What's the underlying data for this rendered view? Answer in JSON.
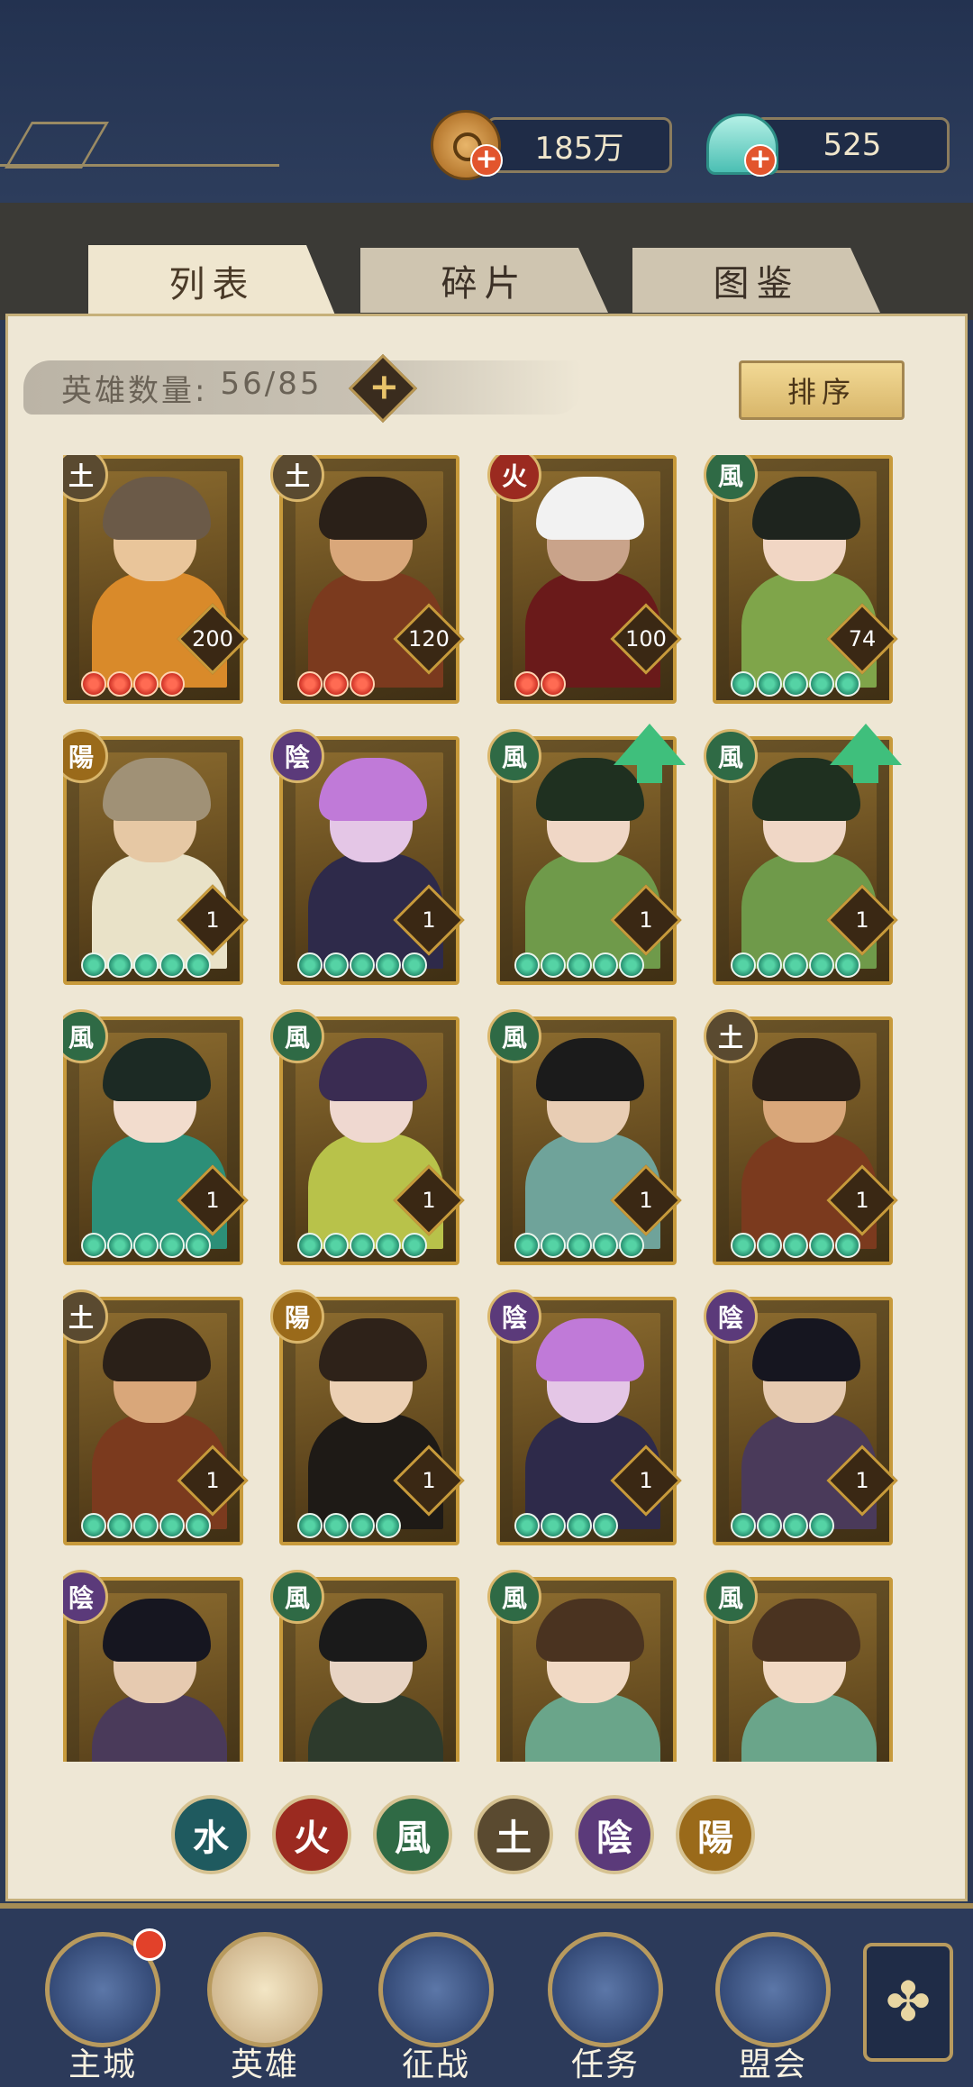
{
  "currency": {
    "coins": "185万",
    "shells": "525"
  },
  "tabs": [
    {
      "label": "列表",
      "active": true
    },
    {
      "label": "碎片",
      "active": false
    },
    {
      "label": "图鉴",
      "active": false
    }
  ],
  "hero_count": {
    "label": "英雄数量:",
    "value": "56/85"
  },
  "sort_button": "排序",
  "element_colors": {
    "土": "#5a4a30",
    "火": "#9b2a20",
    "風": "#2f6a45",
    "陽": "#9a6a1a",
    "陰": "#5b3a7a",
    "水": "#1f5a5f"
  },
  "heroes": [
    {
      "element": "土",
      "level": "200",
      "stars": 4,
      "star_color": "red",
      "upgrade": false,
      "skin": "#e9c59a",
      "hair": "#6b5a48",
      "outfit": "#d98a2a"
    },
    {
      "element": "土",
      "level": "120",
      "stars": 3,
      "star_color": "red",
      "upgrade": false,
      "skin": "#d9a77a",
      "hair": "#2a2018",
      "outfit": "#7b3a1e"
    },
    {
      "element": "火",
      "level": "100",
      "stars": 2,
      "star_color": "red",
      "upgrade": false,
      "skin": "#c9a38a",
      "hair": "#f2f2f2",
      "outfit": "#6a1a1a"
    },
    {
      "element": "風",
      "level": "74",
      "stars": 5,
      "star_color": "green",
      "upgrade": false,
      "skin": "#f1d6c4",
      "hair": "#1e241e",
      "outfit": "#7fa54a"
    },
    {
      "element": "陽",
      "level": "1",
      "stars": 5,
      "star_color": "green",
      "upgrade": false,
      "skin": "#e6c8a4",
      "hair": "#a09176",
      "outfit": "#e9e2c8"
    },
    {
      "element": "陰",
      "level": "1",
      "stars": 5,
      "star_color": "green",
      "upgrade": false,
      "skin": "#e4c6e6",
      "hair": "#c07ad8",
      "outfit": "#2e2a4a"
    },
    {
      "element": "風",
      "level": "1",
      "stars": 5,
      "star_color": "green",
      "upgrade": true,
      "skin": "#f0d7c6",
      "hair": "#1f3020",
      "outfit": "#6f9a4a"
    },
    {
      "element": "風",
      "level": "1",
      "stars": 5,
      "star_color": "green",
      "upgrade": true,
      "skin": "#f0d7c6",
      "hair": "#1f3020",
      "outfit": "#6f9a4a"
    },
    {
      "element": "風",
      "level": "1",
      "stars": 5,
      "star_color": "green",
      "upgrade": false,
      "skin": "#f2dccd",
      "hair": "#1c2a24",
      "outfit": "#2c8f78"
    },
    {
      "element": "風",
      "level": "1",
      "stars": 5,
      "star_color": "green",
      "upgrade": false,
      "skin": "#efd8d0",
      "hair": "#3a2c52",
      "outfit": "#b8c24a"
    },
    {
      "element": "風",
      "level": "1",
      "stars": 5,
      "star_color": "green",
      "upgrade": false,
      "skin": "#e8cdb4",
      "hair": "#1b1b1b",
      "outfit": "#6fa39a"
    },
    {
      "element": "土",
      "level": "1",
      "stars": 5,
      "star_color": "green",
      "upgrade": false,
      "skin": "#d9a77a",
      "hair": "#2a2018",
      "outfit": "#7b3a1e"
    },
    {
      "element": "土",
      "level": "1",
      "stars": 5,
      "star_color": "green",
      "upgrade": false,
      "skin": "#d9a77a",
      "hair": "#2a2018",
      "outfit": "#7b3a1e"
    },
    {
      "element": "陽",
      "level": "1",
      "stars": 4,
      "star_color": "green",
      "upgrade": false,
      "skin": "#ecd0b4",
      "hair": "#2e2219",
      "outfit": "#1e1a16"
    },
    {
      "element": "陰",
      "level": "1",
      "stars": 4,
      "star_color": "green",
      "upgrade": false,
      "skin": "#e4c6e6",
      "hair": "#c07ad8",
      "outfit": "#2e2a4a"
    },
    {
      "element": "陰",
      "level": "1",
      "stars": 4,
      "star_color": "green",
      "upgrade": false,
      "skin": "#e6cab0",
      "hair": "#161620",
      "outfit": "#4a3a5a"
    },
    {
      "element": "陰",
      "level": "",
      "stars": 0,
      "star_color": "green",
      "upgrade": false,
      "skin": "#e6cab0",
      "hair": "#161620",
      "outfit": "#4a3a5a"
    },
    {
      "element": "風",
      "level": "",
      "stars": 0,
      "star_color": "green",
      "upgrade": false,
      "skin": "#e8d4c4",
      "hair": "#1a1a1a",
      "outfit": "#2d3a2c"
    },
    {
      "element": "風",
      "level": "",
      "stars": 0,
      "star_color": "green",
      "upgrade": false,
      "skin": "#f1d9c4",
      "hair": "#4a3320",
      "outfit": "#6aa58a"
    },
    {
      "element": "風",
      "level": "",
      "stars": 0,
      "star_color": "green",
      "upgrade": false,
      "skin": "#f1d9c4",
      "hair": "#4a3320",
      "outfit": "#6aa58a"
    }
  ],
  "filters": [
    {
      "label": "水",
      "color": "#1f5a5f"
    },
    {
      "label": "火",
      "color": "#9b2a20"
    },
    {
      "label": "風",
      "color": "#2f6a45"
    },
    {
      "label": "土",
      "color": "#5a4a30"
    },
    {
      "label": "陰",
      "color": "#5b3a7a"
    },
    {
      "label": "陽",
      "color": "#9a6a1a"
    }
  ],
  "nav": [
    {
      "label": "主城",
      "icon": "city-gate-icon",
      "badge": true
    },
    {
      "label": "英雄",
      "icon": "hero-portrait-icon",
      "active": true
    },
    {
      "label": "征战",
      "icon": "helmet-icon"
    },
    {
      "label": "任务",
      "icon": "scroll-icon"
    },
    {
      "label": "盟会",
      "icon": "pavilion-icon"
    }
  ],
  "nav_extra_icon": "clover-menu-icon"
}
